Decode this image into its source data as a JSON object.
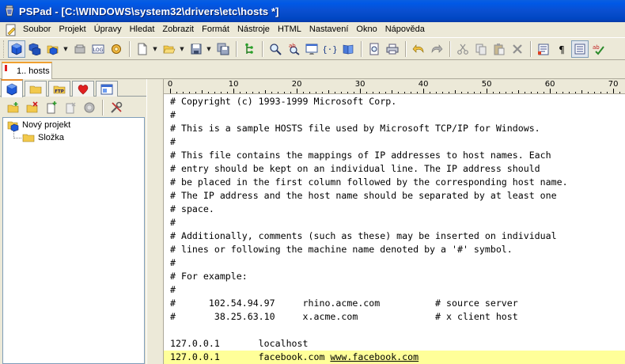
{
  "window": {
    "title": "PSPad - [C:\\WINDOWS\\system32\\drivers\\etc\\hosts *]"
  },
  "menu": [
    "Soubor",
    "Projekt",
    "Úpravy",
    "Hledat",
    "Zobrazit",
    "Formát",
    "Nástroje",
    "HTML",
    "Nastavení",
    "Okno",
    "Nápověda"
  ],
  "toolbar_icons": [
    "project-cube-icon",
    "projects-icon",
    "open-project-icon",
    "log-icon",
    "settings-icon",
    "new-file-icon",
    "open-file-icon",
    "save-icon",
    "save-all-icon",
    "tree-icon",
    "find-icon",
    "replace-icon",
    "preview-icon",
    "code-icon",
    "book-icon",
    "print-preview-icon",
    "print-icon",
    "undo-icon",
    "redo-icon",
    "cut-icon",
    "copy-icon",
    "paste-icon",
    "delete-icon",
    "clipboard-icon",
    "paragraph-icon",
    "wrap-icon",
    "spell-icon"
  ],
  "doc_tabs": [
    {
      "label": "1.. hosts",
      "active": true
    }
  ],
  "left_panel": {
    "tabs": [
      "project-tab",
      "folders-tab",
      "ftp-tab",
      "favorites-tab",
      "clips-tab"
    ],
    "tree": [
      {
        "label": "Nový projekt",
        "level": 0
      },
      {
        "label": "Složka",
        "level": 1
      }
    ]
  },
  "ruler": {
    "labels": [
      "0",
      "10",
      "20",
      "30",
      "40",
      "50",
      "60",
      "70"
    ]
  },
  "editor": {
    "lines": [
      {
        "text": "# Copyright (c) 1993-1999 Microsoft Corp.",
        "highlight": false
      },
      {
        "text": "#",
        "highlight": false
      },
      {
        "text": "# This is a sample HOSTS file used by Microsoft TCP/IP for Windows.",
        "highlight": false
      },
      {
        "text": "#",
        "highlight": false
      },
      {
        "text": "# This file contains the mappings of IP addresses to host names. Each",
        "highlight": false
      },
      {
        "text": "# entry should be kept on an individual line. The IP address should",
        "highlight": false
      },
      {
        "text": "# be placed in the first column followed by the corresponding host name.",
        "highlight": false
      },
      {
        "text": "# The IP address and the host name should be separated by at least one",
        "highlight": false
      },
      {
        "text": "# space.",
        "highlight": false
      },
      {
        "text": "#",
        "highlight": false
      },
      {
        "text": "# Additionally, comments (such as these) may be inserted on individual",
        "highlight": false
      },
      {
        "text": "# lines or following the machine name denoted by a '#' symbol.",
        "highlight": false
      },
      {
        "text": "#",
        "highlight": false
      },
      {
        "text": "# For example:",
        "highlight": false
      },
      {
        "text": "#",
        "highlight": false
      },
      {
        "text": "#      102.54.94.97     rhino.acme.com          # source server",
        "highlight": false
      },
      {
        "text": "#       38.25.63.10     x.acme.com              # x client host",
        "highlight": false
      },
      {
        "text": "",
        "highlight": false
      },
      {
        "text": "127.0.0.1       localhost",
        "highlight": false
      },
      {
        "text": "127.0.0.1       facebook.com ",
        "link": "www.facebook.com",
        "highlight": true
      }
    ]
  }
}
